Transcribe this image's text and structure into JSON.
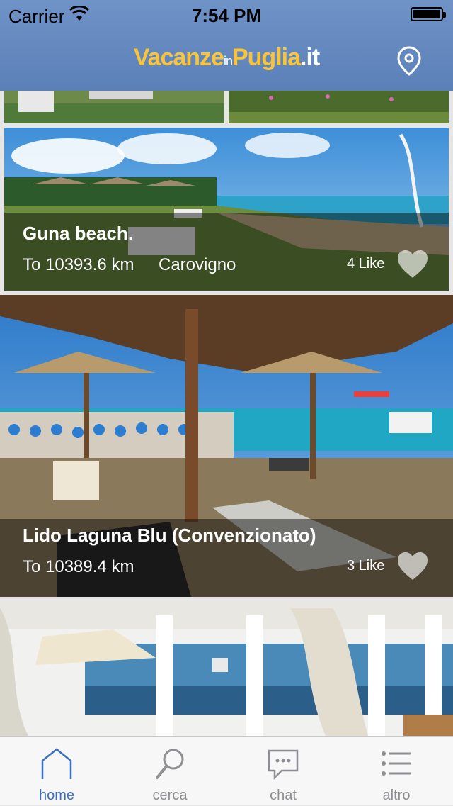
{
  "status_bar": {
    "carrier": "Carrier",
    "time": "7:54 PM"
  },
  "nav": {
    "logo_main": "Vacanze",
    "logo_in": "in",
    "logo_puglia": "Puglia",
    "logo_tld": ".it",
    "map_icon": "location-pin-icon"
  },
  "listings": [
    {
      "title": "Guna beach.",
      "distance": "To 10393.6 km",
      "city": "Carovigno",
      "likes": "4 Like"
    },
    {
      "title": "Lido Laguna Blu (Convenzionato)",
      "distance": "To 10389.4 km",
      "city": "",
      "likes": "3 Like"
    }
  ],
  "tabbar": [
    {
      "label": "home",
      "icon": "home-icon",
      "active": true
    },
    {
      "label": "cerca",
      "icon": "search-icon",
      "active": false
    },
    {
      "label": "chat",
      "icon": "chat-icon",
      "active": false
    },
    {
      "label": "altro",
      "icon": "list-icon",
      "active": false
    }
  ],
  "colors": {
    "nav_bar": "#5b80b8",
    "logo_yellow": "#f7c43a",
    "tab_active": "#3a6fc1",
    "tab_inactive": "#8e8e93"
  }
}
